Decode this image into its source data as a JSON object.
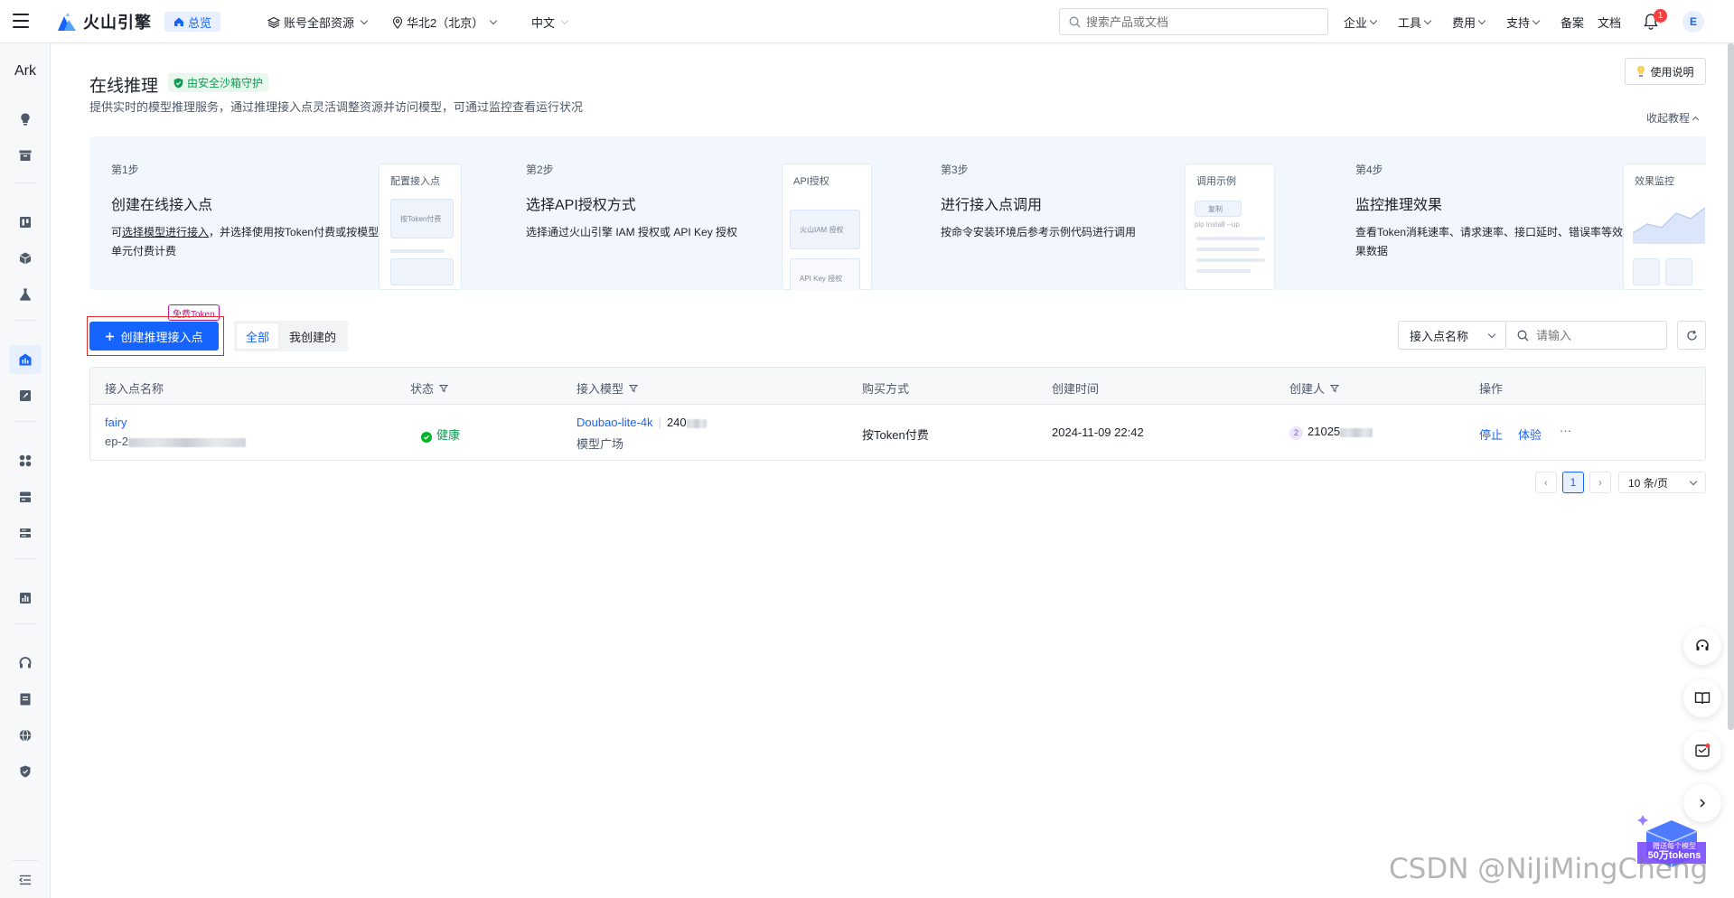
{
  "topbar": {
    "logo": "火山引擎",
    "overview": "总览",
    "account_scope": "账号全部资源",
    "region": "华北2（北京）",
    "language": "中文",
    "search_placeholder": "搜索产品或文档",
    "menu": [
      "企业",
      "工具",
      "费用",
      "支持"
    ],
    "filing": "备案",
    "docs": "文档",
    "notifications": "1",
    "avatar_initial": "E"
  },
  "sidebar": {
    "title": "Ark",
    "icons": [
      "bulb-icon",
      "archive-icon",
      "board-icon",
      "cube-icon",
      "flask-icon",
      "inference-icon",
      "rocket-icon",
      "apps-icon",
      "storage-icon",
      "server-icon",
      "chart-icon",
      "headset-icon",
      "book-icon",
      "globe-icon",
      "shield-icon",
      "collapse-icon"
    ]
  },
  "page": {
    "title": "在线推理",
    "safe_badge": "由安全沙箱守护",
    "description": "提供实时的模型推理服务，通过推理接入点灵活调整资源并访问模型，可通过监控查看运行状况",
    "guide_button": "使用说明",
    "collapse": "收起教程"
  },
  "steps": [
    {
      "num": "第1步",
      "title": "创建在线接入点",
      "desc_pre": "可",
      "desc_link1": "选择模型",
      "desc_link2": "进行接入",
      "desc_post": "，并选择使用按Token付费或按模型单元付费计费",
      "card_label": "配置接入点",
      "card_item": "按Token付费"
    },
    {
      "num": "第2步",
      "title": "选择API授权方式",
      "desc": "选择通过火山引擎 IAM 授权或 API Key 授权",
      "card_label": "API授权",
      "card_item": "火山IAM 授权",
      "card_item2": "API Key 授权"
    },
    {
      "num": "第3步",
      "title": "进行接入点调用",
      "desc": "按命令安装环境后参考示例代码进行调用",
      "card_label": "调用示例",
      "card_item": "复制",
      "card_code": "pip install --up"
    },
    {
      "num": "第4步",
      "title": "监控推理效果",
      "desc": "查看Token消耗速率、请求速率、接口延时、错误率等效果数据",
      "card_label": "效果监控"
    }
  ],
  "toolbar": {
    "create_button": "创建推理接入点",
    "free_tag": "免费Token",
    "tabs": [
      {
        "label": "全部",
        "active": true
      },
      {
        "label": "我创建的",
        "active": false
      }
    ],
    "filter_field": "接入点名称",
    "filter_placeholder": "请输入"
  },
  "table": {
    "columns": [
      "接入点名称",
      "状态",
      "接入模型",
      "购买方式",
      "创建时间",
      "创建人",
      "操作"
    ],
    "rows": [
      {
        "name": "fairy",
        "id_prefix": "ep-2",
        "status": "健康",
        "model": "Doubao-lite-4k",
        "model_version": "240",
        "model_source": "模型广场",
        "purchase": "按Token付费",
        "created_at": "2024-11-09 22:42",
        "creator_badge": "2",
        "creator": "21025",
        "actions": [
          "停止",
          "体验",
          "···"
        ]
      }
    ]
  },
  "pagination": {
    "prev": "‹",
    "current": "1",
    "next": "›",
    "page_size": "10 条/页"
  },
  "promo": {
    "line1": "赠送每个模型",
    "line2": "50万tokens"
  },
  "watermark": "CSDN @NiJiMingCheng",
  "colors": {
    "primary": "#1664ff",
    "success": "#00b42a",
    "danger": "#f53f3f"
  }
}
